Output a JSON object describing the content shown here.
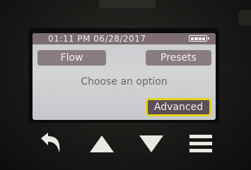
{
  "status_bar": {
    "datetime": "01:11 PM 06/28/2017",
    "battery_icon": "battery-full-icon"
  },
  "buttons": {
    "flow_label": "Flow",
    "presets_label": "Presets",
    "advanced_label": "Advanced"
  },
  "prompt": "Choose an option",
  "hardware_keys": [
    {
      "icon": "back-arrow-icon"
    },
    {
      "icon": "up-triangle-icon"
    },
    {
      "icon": "down-triangle-icon"
    },
    {
      "icon": "menu-icon"
    }
  ],
  "colors": {
    "status_bar": "#7d6d73",
    "button_bg": "#8a7d81",
    "selected_button_bg": "#5d4f55",
    "selection_highlight": "#e2d21c",
    "screen_bg": "#cfd0d3"
  }
}
